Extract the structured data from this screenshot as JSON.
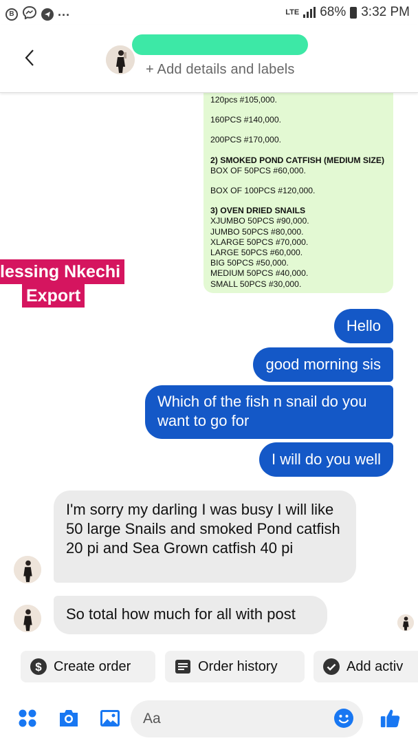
{
  "status_bar": {
    "network": "LTE",
    "battery": "68%",
    "time": "3:32 PM",
    "left_icons": [
      "b-notification-icon",
      "messenger-icon",
      "telegram-icon"
    ],
    "more": "..."
  },
  "header": {
    "subtitle": "+ Add details and labels"
  },
  "price_list": [
    {
      "text": "120pcs #105,000.",
      "bold": false
    },
    {
      "gap": true
    },
    {
      "text": "160PCS #140,000.",
      "bold": false
    },
    {
      "gap": true
    },
    {
      "text": "200PCS #170,000.",
      "bold": false
    },
    {
      "gap": true
    },
    {
      "text": "2) SMOKED POND CATFISH (MEDIUM SIZE)",
      "bold": true
    },
    {
      "text": "BOX OF 50PCS #60,000.",
      "bold": false
    },
    {
      "gap": true
    },
    {
      "text": "BOX OF 100PCS #120,000.",
      "bold": false
    },
    {
      "gap": true
    },
    {
      "text": "3) OVEN DRIED SNAILS",
      "bold": true
    },
    {
      "text": "XJUMBO 50PCS #90,000.",
      "bold": false
    },
    {
      "text": "JUMBO 50PCS #80,000.",
      "bold": false
    },
    {
      "text": "XLARGE 50PCS #70,000.",
      "bold": false
    },
    {
      "text": "LARGE 50PCS #60,000.",
      "bold": false
    },
    {
      "text": "BIG 50PCS #50,000.",
      "bold": false
    },
    {
      "text": "MEDIUM 50PCS #40,000.",
      "bold": false
    },
    {
      "text": "SMALL 50PCS  #30,000.",
      "bold": false
    }
  ],
  "watermark": {
    "line1": "lessing Nkechi",
    "line2": "Export"
  },
  "messages_out": [
    "Hello",
    "good morning sis",
    "Which of the fish n snail do you want to go for",
    "I will do you well"
  ],
  "messages_in": [
    "I'm sorry my darling I was busy I will like 50 large  Snails and smoked Pond catfish 20 pi and Sea Grown catfish 40 pi",
    "So total how much for all with post"
  ],
  "quick_actions": {
    "create_order": "Create order",
    "order_history": "Order history",
    "add_activity": "Add activ"
  },
  "composer": {
    "placeholder": "Aa"
  },
  "colors": {
    "outgoing_bubble": "#1458c7",
    "incoming_bubble": "#ebebeb",
    "price_list_bg": "#e3f9d3",
    "watermark_bg": "#d5155f",
    "messenger_blue": "#1877f2"
  }
}
